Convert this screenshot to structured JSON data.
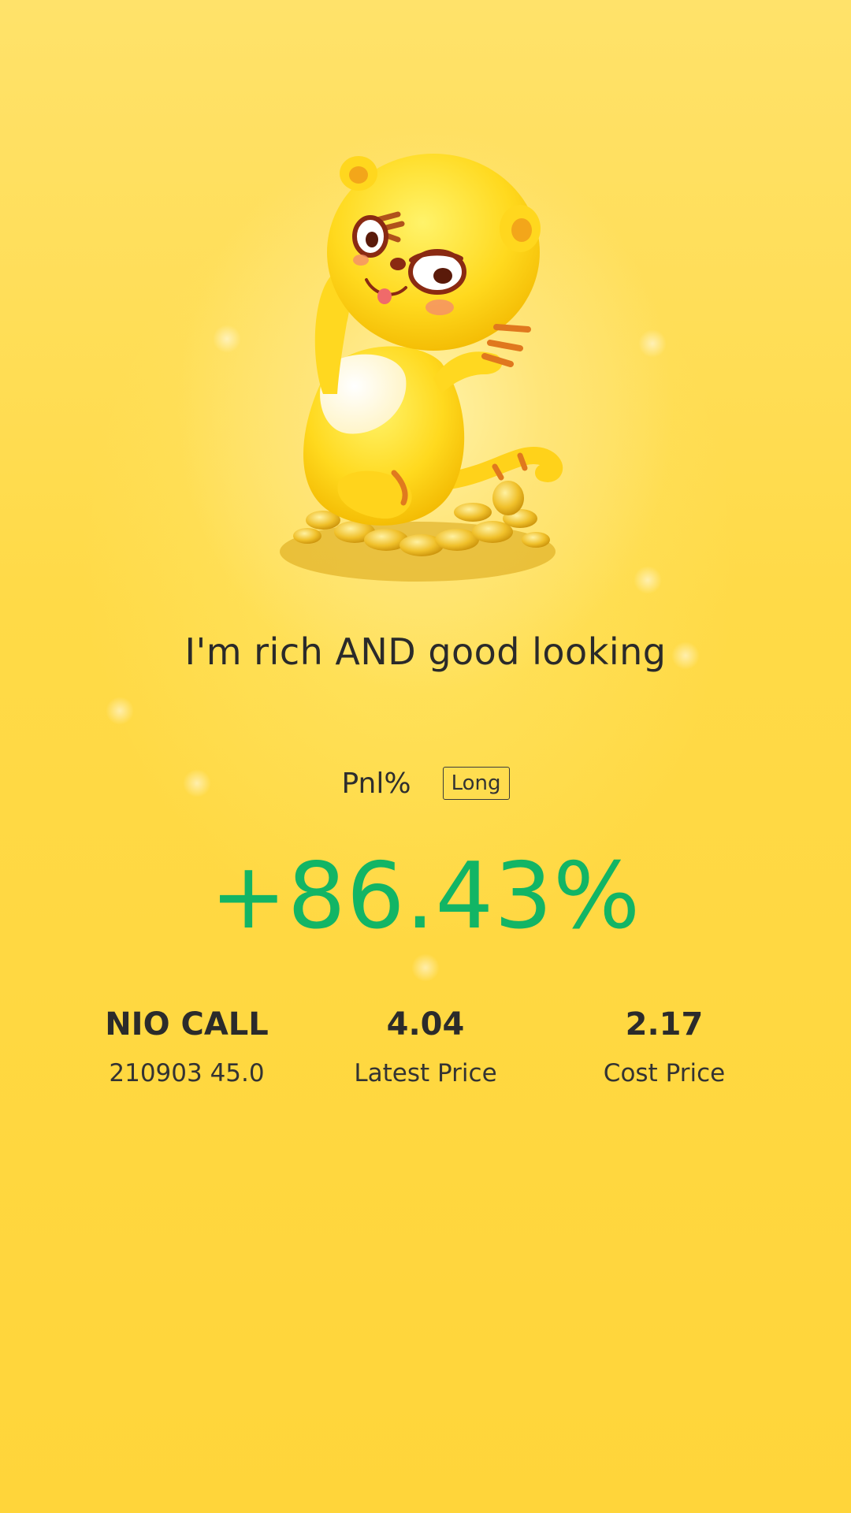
{
  "headline": "I'm rich AND good looking",
  "pnl": {
    "label": "Pnl%",
    "direction_badge": "Long",
    "value": "+86.43%",
    "value_color": "#12b565"
  },
  "position": {
    "symbol": "NIO CALL",
    "contract": "210903 45.0",
    "latest_price": "4.04",
    "latest_price_label": "Latest Price",
    "cost_price": "2.17",
    "cost_price_label": "Cost Price"
  },
  "illustration": {
    "icon": "tiger-mascot-on-coins-icon"
  },
  "colors": {
    "background": "#ffd84a",
    "text": "#2a2a2a",
    "profit": "#12b565"
  }
}
